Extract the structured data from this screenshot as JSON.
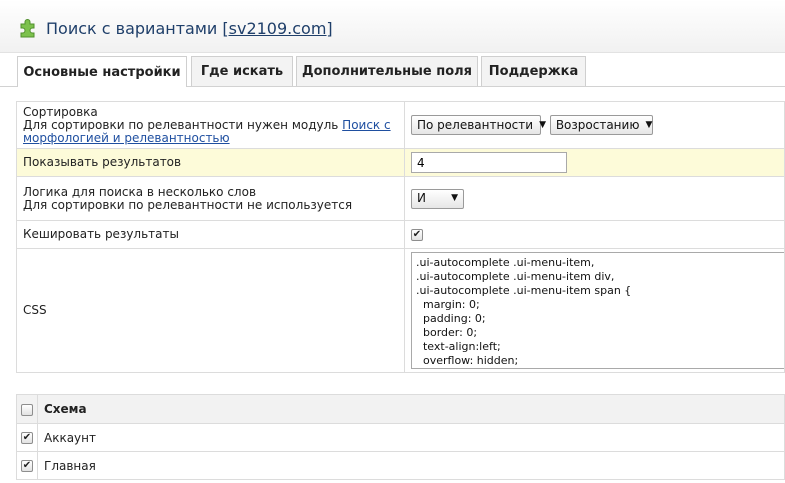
{
  "header": {
    "title_prefix": "Поиск с вариантами ",
    "title_link": "[sv2109.com]"
  },
  "tabs": [
    {
      "label": "Основные настройки",
      "active": true
    },
    {
      "label": "Где искать",
      "active": false
    },
    {
      "label": "Дополнительные поля",
      "active": false
    },
    {
      "label": "Поддержка",
      "active": false
    }
  ],
  "settings": {
    "sort": {
      "label": "Сортировка",
      "hint_prefix": "Для сортировки по релевантности нужен модуль ",
      "hint_link": "Поиск с морфологией и релевантностью",
      "sort_by": "По релевантности",
      "sort_order": "Возростанию"
    },
    "results": {
      "label": "Показывать результатов",
      "value": "4"
    },
    "logic": {
      "label": "Логика для поиска в несколько слов",
      "hint": "Для сортировки по релевантности не используется",
      "value": "И"
    },
    "cache": {
      "label": "Кешировать результаты",
      "checked": true
    },
    "css": {
      "label": "CSS",
      "value": ".ui-autocomplete .ui-menu-item,\n.ui-autocomplete .ui-menu-item div,\n.ui-autocomplete .ui-menu-item span {\n  margin: 0;\n  padding: 0;\n  border: 0;\n  text-align:left;\n  overflow: hidden;"
    }
  },
  "schema": {
    "header": "Схема",
    "rows": [
      {
        "label": "Аккаунт",
        "checked": true
      },
      {
        "label": "Главная",
        "checked": true
      }
    ]
  },
  "icons": {
    "title_icon": "puzzle-piece-icon",
    "check_glyph": "✔",
    "caret_glyph": "▼"
  },
  "colors": {
    "title": "#1f3f6a",
    "link": "#1f4fa0",
    "highlight_row": "#fdfbd9",
    "puzzle": "#7cc14c"
  }
}
